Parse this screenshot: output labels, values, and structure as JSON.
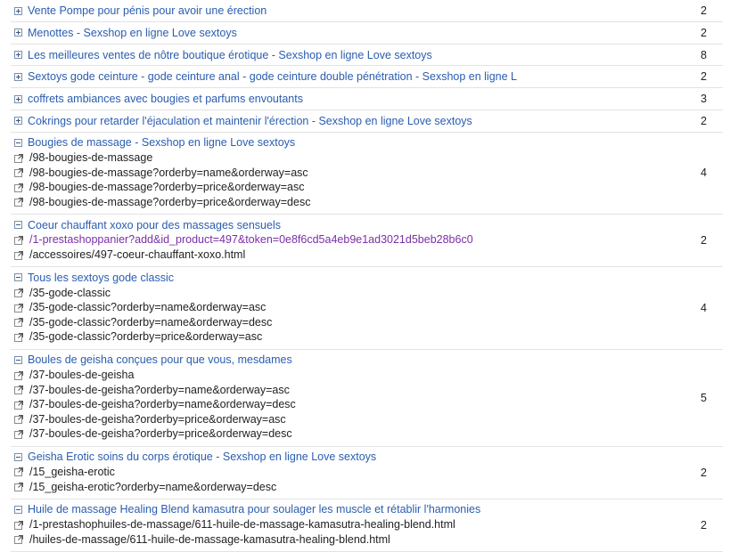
{
  "groups": [
    {
      "title": "Vente Pompe pour pénis pour avoir une érection",
      "count": "2",
      "expanded": false,
      "urls": []
    },
    {
      "title": "Menottes - Sexshop en ligne Love sextoys",
      "count": "2",
      "expanded": false,
      "urls": []
    },
    {
      "title": "Les meilleures ventes de nôtre boutique érotique - Sexshop en ligne Love sextoys",
      "count": "8",
      "expanded": false,
      "urls": []
    },
    {
      "title": "Sextoys gode ceinture - gode ceinture anal - gode ceinture double pénétration - Sexshop en ligne L",
      "count": "2",
      "expanded": false,
      "urls": []
    },
    {
      "title": "coffrets ambiances avec bougies et parfums envoutants",
      "count": "3",
      "expanded": false,
      "urls": []
    },
    {
      "title": "Cokrings pour retarder l'éjaculation et maintenir l'érection - Sexshop en ligne Love sextoys",
      "count": "2",
      "expanded": false,
      "urls": []
    },
    {
      "title": "Bougies de massage - Sexshop en ligne Love sextoys",
      "count": "4",
      "expanded": true,
      "urls": [
        {
          "text": "/98-bougies-de-massage",
          "visited": false
        },
        {
          "text": "/98-bougies-de-massage?orderby=name&orderway=asc",
          "visited": false
        },
        {
          "text": "/98-bougies-de-massage?orderby=price&orderway=asc",
          "visited": false
        },
        {
          "text": "/98-bougies-de-massage?orderby=price&orderway=desc",
          "visited": false
        }
      ]
    },
    {
      "title": "Coeur chauffant xoxo pour des massages sensuels",
      "count": "2",
      "expanded": true,
      "urls": [
        {
          "text": "/1-prestashoppanier?add&id_product=497&token=0e8f6cd5a4eb9e1ad3021d5beb28b6c0",
          "visited": true
        },
        {
          "text": "/accessoires/497-coeur-chauffant-xoxo.html",
          "visited": false
        }
      ]
    },
    {
      "title": "Tous les sextoys gode classic",
      "count": "4",
      "expanded": true,
      "urls": [
        {
          "text": "/35-gode-classic",
          "visited": false
        },
        {
          "text": "/35-gode-classic?orderby=name&orderway=asc",
          "visited": false
        },
        {
          "text": "/35-gode-classic?orderby=name&orderway=desc",
          "visited": false
        },
        {
          "text": "/35-gode-classic?orderby=price&orderway=asc",
          "visited": false
        }
      ]
    },
    {
      "title": "Boules de geisha conçues pour que vous, mesdames",
      "count": "5",
      "expanded": true,
      "urls": [
        {
          "text": "/37-boules-de-geisha",
          "visited": false
        },
        {
          "text": "/37-boules-de-geisha?orderby=name&orderway=asc",
          "visited": false
        },
        {
          "text": "/37-boules-de-geisha?orderby=name&orderway=desc",
          "visited": false
        },
        {
          "text": "/37-boules-de-geisha?orderby=price&orderway=asc",
          "visited": false
        },
        {
          "text": "/37-boules-de-geisha?orderby=price&orderway=desc",
          "visited": false
        }
      ]
    },
    {
      "title": "Geisha Erotic soins du corps érotique - Sexshop en ligne Love sextoys",
      "count": "2",
      "expanded": true,
      "urls": [
        {
          "text": "/15_geisha-erotic",
          "visited": false
        },
        {
          "text": "/15_geisha-erotic?orderby=name&orderway=desc",
          "visited": false
        }
      ]
    },
    {
      "title": "Huile de massage Healing Blend kamasutra pour soulager les muscle et rétablir l'harmonies",
      "count": "2",
      "expanded": true,
      "urls": [
        {
          "text": "/1-prestashophuiles-de-massage/611-huile-de-massage-kamasutra-healing-blend.html",
          "visited": false
        },
        {
          "text": "/huiles-de-massage/611-huile-de-massage-kamasutra-healing-blend.html",
          "visited": false
        }
      ]
    }
  ],
  "colors": {
    "link": "#2a5db0",
    "visited": "#7b2fa8",
    "text": "#222222",
    "divider": "#e3e3e3"
  },
  "icons": {
    "expand": "plus-box-icon",
    "collapse": "minus-box-icon",
    "url": "external-link-icon"
  }
}
